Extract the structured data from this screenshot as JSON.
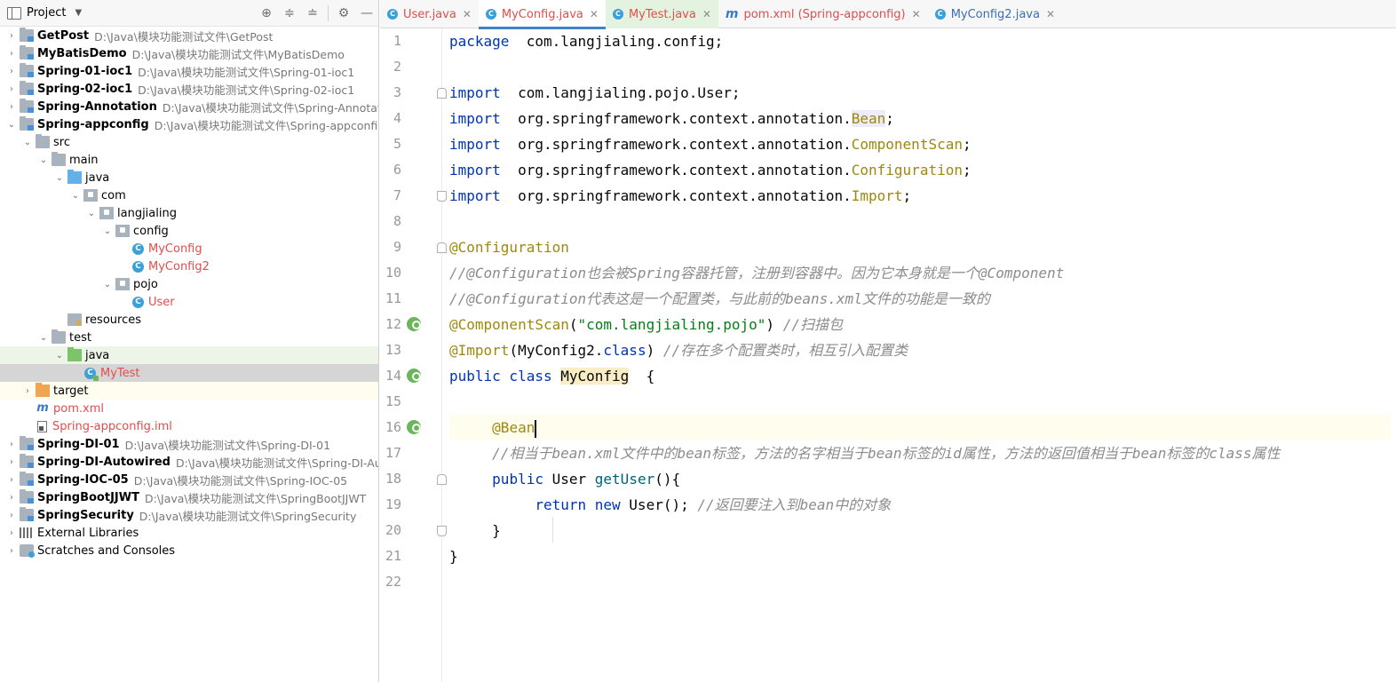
{
  "project_panel": {
    "title": "Project",
    "tree": [
      {
        "arrow": "›",
        "depth": 0,
        "icon": "module",
        "name": "GetPost",
        "path": "D:\\Java\\模块功能测试文件\\GetPost",
        "style": "bold"
      },
      {
        "arrow": "›",
        "depth": 0,
        "icon": "module",
        "name": "MyBatisDemo",
        "path": "D:\\Java\\模块功能测试文件\\MyBatisDemo",
        "style": "bold"
      },
      {
        "arrow": "›",
        "depth": 0,
        "icon": "module",
        "name": "Spring-01-ioc1",
        "path": "D:\\Java\\模块功能测试文件\\Spring-01-ioc1",
        "style": "bold"
      },
      {
        "arrow": "›",
        "depth": 0,
        "icon": "module",
        "name": "Spring-02-ioc1",
        "path": "D:\\Java\\模块功能测试文件\\Spring-02-ioc1",
        "style": "bold"
      },
      {
        "arrow": "›",
        "depth": 0,
        "icon": "module",
        "name": "Spring-Annotation",
        "path": "D:\\Java\\模块功能测试文件\\Spring-Annotation",
        "style": "bold"
      },
      {
        "arrow": "⌄",
        "depth": 0,
        "icon": "module",
        "name": "Spring-appconfig",
        "path": "D:\\Java\\模块功能测试文件\\Spring-appconfig",
        "style": "bold"
      },
      {
        "arrow": "⌄",
        "depth": 1,
        "icon": "folder",
        "name": "src",
        "path": "",
        "style": "norm"
      },
      {
        "arrow": "⌄",
        "depth": 2,
        "icon": "folder",
        "name": "main",
        "path": "",
        "style": "norm"
      },
      {
        "arrow": "⌄",
        "depth": 3,
        "icon": "src",
        "name": "java",
        "path": "",
        "style": "norm"
      },
      {
        "arrow": "⌄",
        "depth": 4,
        "icon": "pkg",
        "name": "com",
        "path": "",
        "style": "norm"
      },
      {
        "arrow": "⌄",
        "depth": 5,
        "icon": "pkg",
        "name": "langjialing",
        "path": "",
        "style": "norm"
      },
      {
        "arrow": "⌄",
        "depth": 6,
        "icon": "pkg",
        "name": "config",
        "path": "",
        "style": "norm"
      },
      {
        "arrow": "",
        "depth": 7,
        "icon": "class",
        "name": "MyConfig",
        "path": "",
        "style": "red"
      },
      {
        "arrow": "",
        "depth": 7,
        "icon": "class",
        "name": "MyConfig2",
        "path": "",
        "style": "red"
      },
      {
        "arrow": "⌄",
        "depth": 6,
        "icon": "pkg",
        "name": "pojo",
        "path": "",
        "style": "norm"
      },
      {
        "arrow": "",
        "depth": 7,
        "icon": "class",
        "name": "User",
        "path": "",
        "style": "red"
      },
      {
        "arrow": "",
        "depth": 3,
        "icon": "res",
        "name": "resources",
        "path": "",
        "style": "norm"
      },
      {
        "arrow": "⌄",
        "depth": 2,
        "icon": "folder",
        "name": "test",
        "path": "",
        "style": "norm"
      },
      {
        "arrow": "⌄",
        "depth": 3,
        "icon": "test",
        "name": "java",
        "path": "",
        "style": "norm",
        "bg": "sel-light"
      },
      {
        "arrow": "",
        "depth": 4,
        "icon": "test-class",
        "name": "MyTest",
        "path": "",
        "style": "red",
        "bg": "sel-gray"
      },
      {
        "arrow": "›",
        "depth": 1,
        "icon": "target",
        "name": "target",
        "path": "",
        "style": "norm",
        "bg": "sel-yellow"
      },
      {
        "arrow": "",
        "depth": 1,
        "icon": "maven",
        "name": "pom.xml",
        "path": "",
        "style": "red"
      },
      {
        "arrow": "",
        "depth": 1,
        "icon": "iml",
        "name": "Spring-appconfig.iml",
        "path": "",
        "style": "red"
      },
      {
        "arrow": "›",
        "depth": 0,
        "icon": "module",
        "name": "Spring-DI-01",
        "path": "D:\\Java\\模块功能测试文件\\Spring-DI-01",
        "style": "bold"
      },
      {
        "arrow": "›",
        "depth": 0,
        "icon": "module",
        "name": "Spring-DI-Autowired",
        "path": "D:\\Java\\模块功能测试文件\\Spring-DI-Autowi",
        "style": "bold"
      },
      {
        "arrow": "›",
        "depth": 0,
        "icon": "module",
        "name": "Spring-IOC-05",
        "path": "D:\\Java\\模块功能测试文件\\Spring-IOC-05",
        "style": "bold"
      },
      {
        "arrow": "›",
        "depth": 0,
        "icon": "module",
        "name": "SpringBootJJWT",
        "path": "D:\\Java\\模块功能测试文件\\SpringBootJJWT",
        "style": "bold"
      },
      {
        "arrow": "›",
        "depth": 0,
        "icon": "module",
        "name": "SpringSecurity",
        "path": "D:\\Java\\模块功能测试文件\\SpringSecurity",
        "style": "bold"
      },
      {
        "arrow": "›",
        "depth": 0,
        "icon": "libs",
        "name": "External Libraries",
        "path": "",
        "style": "norm"
      },
      {
        "arrow": "›",
        "depth": 0,
        "icon": "scratch",
        "name": "Scratches and Consoles",
        "path": "",
        "style": "norm"
      }
    ]
  },
  "tabs": [
    {
      "label": "User.java",
      "icon": "class",
      "state": "normal",
      "color": "red"
    },
    {
      "label": "MyConfig.java",
      "icon": "class",
      "state": "active",
      "color": "red"
    },
    {
      "label": "MyTest.java",
      "icon": "class",
      "state": "highlight",
      "color": "red"
    },
    {
      "label": "pom.xml (Spring-appconfig)",
      "icon": "maven",
      "state": "normal",
      "color": "red"
    },
    {
      "label": "MyConfig2.java",
      "icon": "class",
      "state": "normal",
      "color": "blue"
    }
  ],
  "editor": {
    "line_numbers": [
      "1",
      "2",
      "3",
      "4",
      "5",
      "6",
      "7",
      "8",
      "9",
      "10",
      "11",
      "12",
      "13",
      "14",
      "15",
      "16",
      "17",
      "18",
      "19",
      "20",
      "21",
      "22"
    ],
    "lines": [
      [
        [
          "kw",
          "package"
        ],
        [
          "",
          "  com.langjialing.config;"
        ]
      ],
      [],
      [
        [
          "kw",
          "import"
        ],
        [
          "",
          "  com.langjialing.pojo.User;"
        ]
      ],
      [
        [
          "kw",
          "import"
        ],
        [
          "",
          "  org.springframework.context.annotation."
        ],
        [
          "imp-cls hl-bean",
          "Bean"
        ],
        [
          "",
          ";"
        ]
      ],
      [
        [
          "kw",
          "import"
        ],
        [
          "",
          "  org.springframework.context.annotation."
        ],
        [
          "imp-cls",
          "ComponentScan"
        ],
        [
          "",
          ";"
        ]
      ],
      [
        [
          "kw",
          "import"
        ],
        [
          "",
          "  org.springframework.context.annotation."
        ],
        [
          "imp-cls",
          "Configuration"
        ],
        [
          "",
          ";"
        ]
      ],
      [
        [
          "kw",
          "import"
        ],
        [
          "",
          "  org.springframework.context.annotation."
        ],
        [
          "imp-cls",
          "Import"
        ],
        [
          "",
          ";"
        ]
      ],
      [],
      [
        [
          "ann",
          "@Configuration"
        ]
      ],
      [
        [
          "cmt",
          "//@Configuration也会被Spring容器托管，注册到容器中。因为它本身就是一个@Component"
        ]
      ],
      [
        [
          "cmt",
          "//@Configuration代表这是一个配置类，与此前的beans.xml文件的功能是一致的"
        ]
      ],
      [
        [
          "ann",
          "@ComponentScan"
        ],
        [
          "",
          "("
        ],
        [
          "str",
          "\"com.langjialing.pojo\""
        ],
        [
          "",
          ") "
        ],
        [
          "cmt",
          "//扫描包"
        ]
      ],
      [
        [
          "ann",
          "@Import"
        ],
        [
          "",
          "(MyConfig2."
        ],
        [
          "kw",
          "class"
        ],
        [
          "",
          ") "
        ],
        [
          "cmt",
          "//存在多个配置类时，相互引入配置类"
        ]
      ],
      [
        [
          "kw",
          "public class "
        ],
        [
          "cls-hl",
          "MyConfig"
        ],
        [
          "",
          ""
        ],
        [
          "",
          "  {"
        ]
      ],
      [],
      [
        [
          "",
          "     "
        ],
        [
          "ann",
          "@Bean"
        ]
      ],
      [
        [
          "",
          "     "
        ],
        [
          "cmt",
          "//相当于bean.xml文件中的bean标签，方法的名字相当于bean标签的id属性，方法的返回值相当于bean标签的class属性"
        ]
      ],
      [
        [
          "",
          "     "
        ],
        [
          "kw",
          "public "
        ],
        [
          "",
          "User "
        ],
        [
          "fn",
          "getUser"
        ],
        [
          "",
          "(){"
        ]
      ],
      [
        [
          "",
          "          "
        ],
        [
          "kw",
          "return new "
        ],
        [
          "",
          "User(); "
        ],
        [
          "cmt",
          "//返回要注入到bean中的对象"
        ]
      ],
      [
        [
          "",
          "     }"
        ]
      ],
      [
        [
          "",
          "}"
        ]
      ],
      []
    ]
  }
}
